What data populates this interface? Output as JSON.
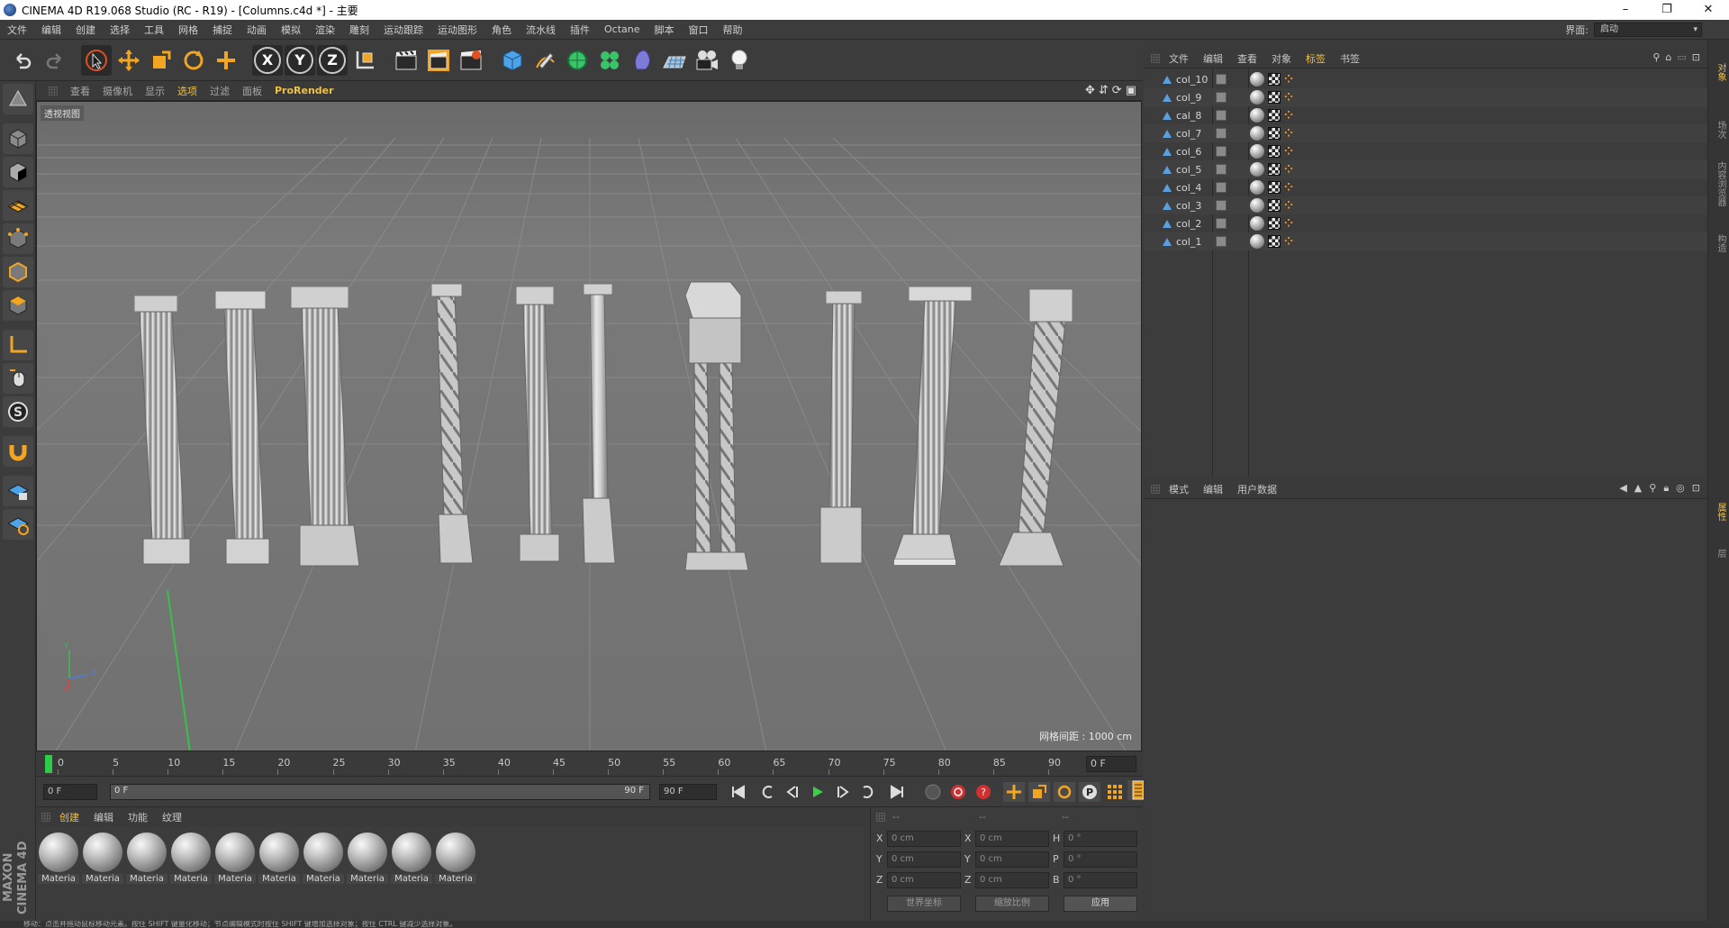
{
  "titlebar": {
    "title": "CINEMA 4D R19.068 Studio (RC - R19) - [Columns.c4d *] - 主要",
    "minimize": "–",
    "restore": "❐",
    "close": "✕"
  },
  "menubar": {
    "items": [
      "文件",
      "编辑",
      "创建",
      "选择",
      "工具",
      "网格",
      "捕捉",
      "动画",
      "模拟",
      "渲染",
      "雕刻",
      "运动跟踪",
      "运动图形",
      "角色",
      "流水线",
      "插件",
      "Octane",
      "脚本",
      "窗口",
      "帮助"
    ],
    "layout_label": "界面:",
    "layout_value": "启动"
  },
  "viewport": {
    "menu": [
      "查看",
      "摄像机",
      "显示",
      "选项",
      "过滤",
      "面板"
    ],
    "active_menu": "选项",
    "prorender": "ProRender",
    "label": "透视视图",
    "grid_spacing": "网格间距 : 1000 cm",
    "axis_labels": {
      "y": "Y",
      "z": "Z",
      "x": "X"
    }
  },
  "timeline": {
    "ticks": [
      "0",
      "5",
      "10",
      "15",
      "20",
      "25",
      "30",
      "35",
      "40",
      "45",
      "50",
      "55",
      "60",
      "65",
      "70",
      "75",
      "80",
      "85",
      "90"
    ],
    "current_frame_field": "0 F"
  },
  "playbar": {
    "start_field": "0 F",
    "range_start": "0 F",
    "range_end": "90 F",
    "end_field": "90 F"
  },
  "material_panel": {
    "menu": [
      "创建",
      "编辑",
      "功能",
      "纹理"
    ],
    "materials": [
      "Materia",
      "Materia",
      "Materia",
      "Materia",
      "Materia",
      "Materia",
      "Materia",
      "Materia",
      "Materia",
      "Materia"
    ]
  },
  "coords": {
    "header": [
      "--",
      "--",
      "--"
    ],
    "rows": [
      {
        "l1": "X",
        "v1": "0 cm",
        "l2": "X",
        "v2": "0 cm",
        "l3": "H",
        "v3": "0 °"
      },
      {
        "l1": "Y",
        "v1": "0 cm",
        "l2": "Y",
        "v2": "0 cm",
        "l3": "P",
        "v3": "0 °"
      },
      {
        "l1": "Z",
        "v1": "0 cm",
        "l2": "Z",
        "v2": "0 cm",
        "l3": "B",
        "v3": "0 °"
      }
    ],
    "world_btn": "世界坐标",
    "scale_btn": "缩放比例",
    "apply_btn": "应用"
  },
  "object_manager": {
    "menu": [
      "文件",
      "编辑",
      "查看",
      "对象",
      "标签",
      "书签"
    ],
    "active_menu": "标签",
    "objects": [
      "col_10",
      "col_9",
      "cal_8",
      "col_7",
      "col_6",
      "col_5",
      "col_4",
      "col_3",
      "col_2",
      "col_1"
    ]
  },
  "attribute_manager": {
    "menu": [
      "模式",
      "编辑",
      "用户数据"
    ]
  },
  "right_tabs": [
    "对象",
    "场次",
    "内容浏览器",
    "构造"
  ],
  "right_tabs_lower": [
    "属性",
    "层"
  ],
  "logo": "MAXON CINEMA 4D",
  "statusbar": "移动：点击并拖动鼠标移动元素。按住 SHIFT 键量化移动；节点编辑模式时按住 SHIFT 键增加选择对象；按住 CTRL 键减少选择对象。",
  "colors": {
    "accent": "#f0c040",
    "timeline_cursor": "#2dcd4a",
    "tag_dot": "#ff9a1f"
  },
  "icons": {
    "toolbar": [
      "undo-icon",
      "redo-icon",
      "select-arrow-icon",
      "move-icon",
      "scale-icon",
      "rotate-icon",
      "add-icon",
      "x-axis-icon",
      "y-axis-icon",
      "z-axis-icon",
      "coord-system-icon",
      "render-view-icon",
      "render-picture-icon",
      "render-settings-icon",
      "cube-icon",
      "pen-icon",
      "subdivision-icon",
      "cloner-icon",
      "deformer-icon",
      "floor-icon",
      "camera-icon",
      "light-icon"
    ]
  }
}
